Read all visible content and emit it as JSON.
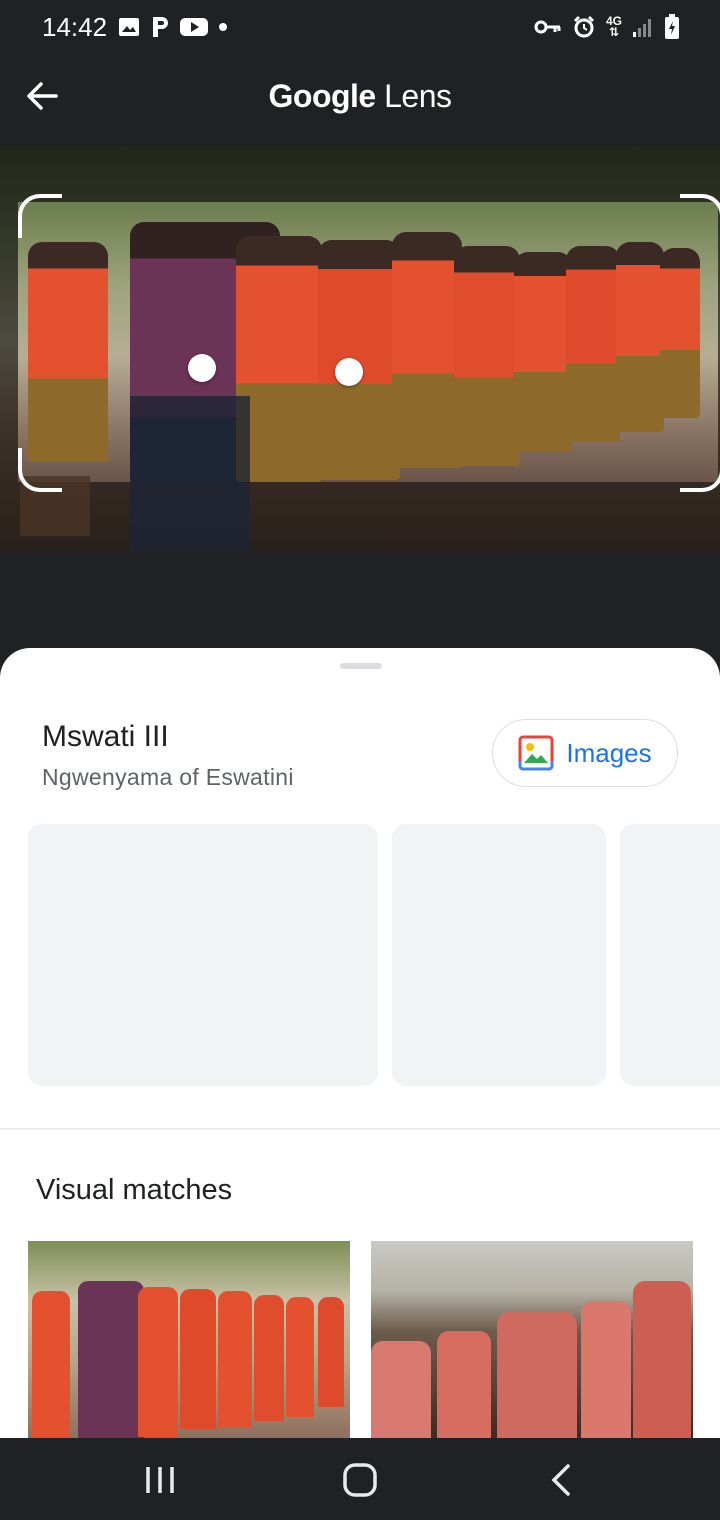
{
  "status_bar": {
    "time": "14:42",
    "network": "4G",
    "left_icons": [
      "gallery-icon",
      "p-app-icon",
      "youtube-icon",
      "dot-icon"
    ],
    "right_icons": [
      "vpn-key-icon",
      "alarm-icon",
      "network-4g-icon",
      "signal-icon",
      "battery-icon"
    ]
  },
  "header": {
    "title_brand": "Google",
    "title_product": "Lens"
  },
  "result": {
    "title": "Mswati III",
    "subtitle": "Ngwenyama of Eswatini",
    "images_button_label": "Images"
  },
  "visual_matches": {
    "title": "Visual matches"
  },
  "colors": {
    "dark_bg": "#202124",
    "accent_blue": "#1a73e8",
    "card_bg": "#f1f3f4",
    "dress_red": "#d8452b"
  }
}
